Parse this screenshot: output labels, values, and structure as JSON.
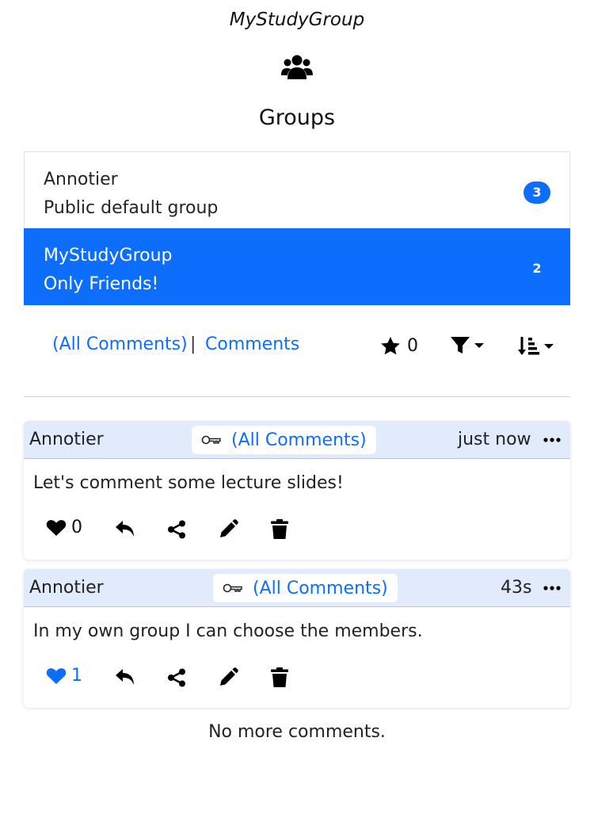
{
  "header": {
    "app_title": "MyStudyGroup",
    "groups_icon": "users-icon",
    "heading": "Groups"
  },
  "groups": [
    {
      "name": "Annotier",
      "description": "Public default group",
      "count": "3",
      "active": false
    },
    {
      "name": "MyStudyGroup",
      "description": "Only Friends!",
      "count": "2",
      "active": true
    }
  ],
  "filter_bar": {
    "tab_all": "(All Comments)",
    "separator": "|",
    "tab_comments": "Comments",
    "star_count": "0",
    "filter_icon": "filter-icon",
    "sort_icon": "sort-amount-down-icon"
  },
  "comments": [
    {
      "author": "Annotier",
      "group_chip": "(All Comments)",
      "time": "just now",
      "text": "Let's comment some lecture slides!",
      "likes": "0",
      "liked": false
    },
    {
      "author": "Annotier",
      "group_chip": "(All Comments)",
      "time": "43s",
      "text": "In my own group I can choose the members.",
      "likes": "1",
      "liked": true
    }
  ],
  "footer": {
    "no_more": "No more comments."
  },
  "colors": {
    "accent": "#0d6efd",
    "header_bg": "#e1ebfb",
    "text": "#212529"
  }
}
